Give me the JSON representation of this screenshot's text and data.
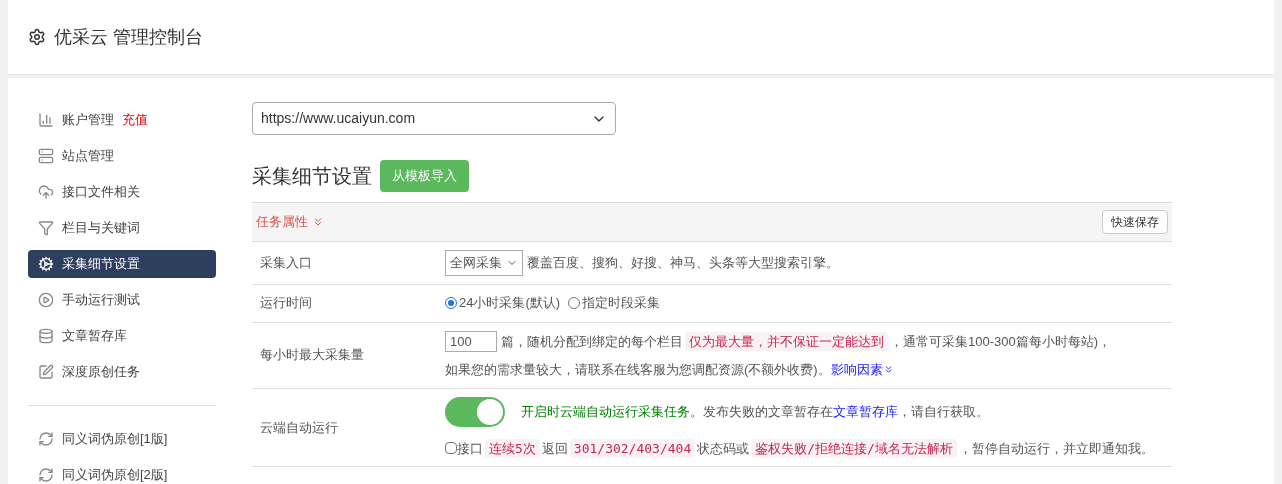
{
  "header": {
    "title": "优采云 管理控制台"
  },
  "sidebar": {
    "items": [
      {
        "kind": "item",
        "label": "账户管理",
        "badge": "充值",
        "selected": false
      },
      {
        "kind": "item",
        "label": "站点管理",
        "selected": false
      },
      {
        "kind": "item",
        "label": "接口文件相关",
        "selected": false
      },
      {
        "kind": "item",
        "label": "栏目与关键词",
        "selected": false
      },
      {
        "kind": "item",
        "label": "采集细节设置",
        "selected": true
      },
      {
        "kind": "item",
        "label": "手动运行测试",
        "selected": false
      },
      {
        "kind": "item",
        "label": "文章暂存库",
        "selected": false
      },
      {
        "kind": "item",
        "label": "深度原创任务",
        "selected": false
      },
      {
        "kind": "divider"
      },
      {
        "kind": "item",
        "label": "同义词伪原创[1版]",
        "selected": false
      },
      {
        "kind": "item",
        "label": "同义词伪原创[2版]",
        "selected": false
      }
    ]
  },
  "site_select": {
    "value": "https://www.ucaiyun.com"
  },
  "section": {
    "title": "采集细节设置",
    "import_button": "从模板导入"
  },
  "panel": {
    "title": "任务属性",
    "save_button": "快速保存",
    "rows": [
      {
        "kind": "select",
        "label": "采集入口",
        "value": "全网采集",
        "description": "覆盖百度、搜狗、好搜、神马、头条等大型搜索引擎。"
      },
      {
        "kind": "radio",
        "label": "运行时间",
        "options": [
          {
            "label": "24小时采集(默认)",
            "selected": true
          },
          {
            "label": "指定时段采集",
            "selected": false
          }
        ]
      },
      {
        "kind": "amount",
        "label": "每小时最大采集量",
        "value": "100",
        "text_before": "篇，随机分配到绑定的每个栏目",
        "code": "仅为最大量，并不保证一定能达到",
        "text_after": "，通常可采集100-300篇每小时每站)，",
        "note": "如果您的需求量较大，请联系在线客服为您调配资源(不额外收费)。",
        "link": "影响因素"
      },
      {
        "kind": "toggle",
        "label": "云端自动运行",
        "on": true,
        "toggle_text": "开启时云端自动运行采集任务。",
        "text": "发布失败的文章暂存在",
        "link": "文章暂存库",
        "text_end": "，请自行获取。",
        "alert": {
          "checked": false,
          "parts": [
            {
              "kind": "text",
              "text": "接口"
            },
            {
              "kind": "code",
              "text": "连续5次"
            },
            {
              "kind": "text",
              "text": "返回"
            },
            {
              "kind": "code",
              "text": "301/302/403/404"
            },
            {
              "kind": "text",
              "text": "状态码或"
            },
            {
              "kind": "code",
              "text": "鉴权失败/拒绝连接/域名无法解析"
            },
            {
              "kind": "text",
              "text": "，暂停自动运行，并立即通知我。"
            }
          ]
        }
      }
    ]
  }
}
